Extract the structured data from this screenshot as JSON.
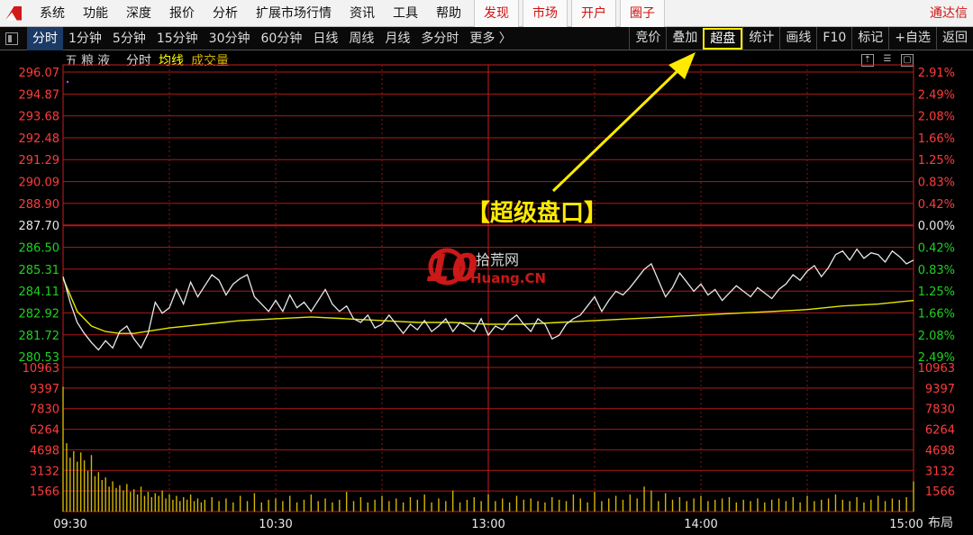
{
  "menubar": {
    "items": [
      "系统",
      "功能",
      "深度",
      "报价",
      "分析",
      "扩展市场行情",
      "资讯",
      "工具",
      "帮助"
    ],
    "red_items": [
      "发现",
      "市场",
      "开户",
      "圈子"
    ],
    "brand": "通达信"
  },
  "toolbar": {
    "periods": [
      "分时",
      "1分钟",
      "5分钟",
      "15分钟",
      "30分钟",
      "60分钟",
      "日线",
      "周线",
      "月线",
      "多分时"
    ],
    "more": "更多 〉",
    "right_buttons": [
      "竞价",
      "叠加",
      "超盘",
      "统计",
      "画线",
      "F10",
      "标记",
      "+自选",
      "返回"
    ],
    "highlighted": "超盘"
  },
  "chart_header": {
    "stock_name": "五粮液",
    "mode": "分时",
    "avg_line": "均线",
    "volume": "成交量"
  },
  "annotation": {
    "label": "【超级盘口】"
  },
  "watermark": {
    "digits": "10",
    "cn": "拾荒网",
    "en": "Huang.CN"
  },
  "bottom_button": "布局",
  "colors": {
    "up": "#ff3b3b",
    "down": "#21d021",
    "avg": "#e6e600",
    "price": "#e8e8e8",
    "volume": "#d4b400",
    "highlight": "#ffea00"
  },
  "chart_data": {
    "type": "line",
    "price_axis": {
      "labels": [
        "296.07",
        "294.87",
        "293.68",
        "292.48",
        "291.29",
        "290.09",
        "288.90",
        "287.70",
        "286.50",
        "285.31",
        "284.11",
        "282.92",
        "281.72",
        "280.53"
      ],
      "ylim": [
        280.53,
        296.07
      ],
      "reference": 287.7
    },
    "pct_axis": {
      "labels": [
        "2.91%",
        "2.49%",
        "2.08%",
        "1.66%",
        "1.25%",
        "0.83%",
        "0.42%",
        "0.00%",
        "0.42%",
        "0.83%",
        "1.25%",
        "1.66%",
        "2.08%",
        "2.49%"
      ]
    },
    "volume_axis": {
      "labels": [
        "10963",
        "9397",
        "7830",
        "6264",
        "4698",
        "3132",
        "1566"
      ],
      "ylim": [
        0,
        10963
      ]
    },
    "time_labels": [
      "09:30",
      "10:30",
      "13:00",
      "14:00",
      "15:00"
    ],
    "minutes_total": 240,
    "price": [
      [
        0,
        284.9
      ],
      [
        2,
        283.5
      ],
      [
        4,
        282.4
      ],
      [
        6,
        281.8
      ],
      [
        8,
        281.3
      ],
      [
        10,
        280.9
      ],
      [
        12,
        281.4
      ],
      [
        14,
        281.0
      ],
      [
        16,
        281.9
      ],
      [
        18,
        282.2
      ],
      [
        20,
        281.5
      ],
      [
        22,
        281.0
      ],
      [
        24,
        281.8
      ],
      [
        26,
        283.5
      ],
      [
        28,
        282.9
      ],
      [
        30,
        283.2
      ],
      [
        32,
        284.2
      ],
      [
        34,
        283.4
      ],
      [
        36,
        284.6
      ],
      [
        38,
        283.8
      ],
      [
        40,
        284.4
      ],
      [
        42,
        285.0
      ],
      [
        44,
        284.7
      ],
      [
        46,
        283.9
      ],
      [
        48,
        284.5
      ],
      [
        50,
        284.8
      ],
      [
        52,
        285.0
      ],
      [
        54,
        283.8
      ],
      [
        56,
        283.4
      ],
      [
        58,
        283.0
      ],
      [
        60,
        283.6
      ],
      [
        62,
        283.0
      ],
      [
        64,
        283.9
      ],
      [
        66,
        283.2
      ],
      [
        68,
        283.5
      ],
      [
        70,
        283.0
      ],
      [
        72,
        283.6
      ],
      [
        74,
        284.2
      ],
      [
        76,
        283.4
      ],
      [
        78,
        283.0
      ],
      [
        80,
        283.3
      ],
      [
        82,
        282.6
      ],
      [
        84,
        282.4
      ],
      [
        86,
        282.8
      ],
      [
        88,
        282.1
      ],
      [
        90,
        282.3
      ],
      [
        92,
        282.8
      ],
      [
        94,
        282.3
      ],
      [
        96,
        281.8
      ],
      [
        98,
        282.3
      ],
      [
        100,
        282.0
      ],
      [
        102,
        282.5
      ],
      [
        104,
        281.9
      ],
      [
        106,
        282.2
      ],
      [
        108,
        282.6
      ],
      [
        110,
        281.9
      ],
      [
        112,
        282.4
      ],
      [
        114,
        282.2
      ],
      [
        116,
        281.9
      ],
      [
        118,
        282.6
      ],
      [
        120,
        281.7
      ],
      [
        122,
        282.2
      ],
      [
        124,
        282.0
      ],
      [
        126,
        282.5
      ],
      [
        128,
        282.8
      ],
      [
        130,
        282.3
      ],
      [
        132,
        281.9
      ],
      [
        134,
        282.6
      ],
      [
        136,
        282.3
      ],
      [
        138,
        281.5
      ],
      [
        140,
        281.7
      ],
      [
        142,
        282.3
      ],
      [
        144,
        282.6
      ],
      [
        146,
        282.8
      ],
      [
        148,
        283.3
      ],
      [
        150,
        283.8
      ],
      [
        152,
        283.0
      ],
      [
        154,
        283.6
      ],
      [
        156,
        284.1
      ],
      [
        158,
        283.9
      ],
      [
        160,
        284.3
      ],
      [
        162,
        284.8
      ],
      [
        164,
        285.3
      ],
      [
        166,
        285.6
      ],
      [
        168,
        284.7
      ],
      [
        170,
        283.8
      ],
      [
        172,
        284.3
      ],
      [
        174,
        285.1
      ],
      [
        176,
        284.6
      ],
      [
        178,
        284.1
      ],
      [
        180,
        284.5
      ],
      [
        182,
        283.9
      ],
      [
        184,
        284.2
      ],
      [
        186,
        283.6
      ],
      [
        188,
        284.0
      ],
      [
        190,
        284.4
      ],
      [
        192,
        284.1
      ],
      [
        194,
        283.8
      ],
      [
        196,
        284.3
      ],
      [
        198,
        284.0
      ],
      [
        200,
        283.7
      ],
      [
        202,
        284.2
      ],
      [
        204,
        284.5
      ],
      [
        206,
        285.0
      ],
      [
        208,
        284.7
      ],
      [
        210,
        285.2
      ],
      [
        212,
        285.5
      ],
      [
        214,
        284.9
      ],
      [
        216,
        285.4
      ],
      [
        218,
        286.1
      ],
      [
        220,
        286.3
      ],
      [
        222,
        285.8
      ],
      [
        224,
        286.4
      ],
      [
        226,
        285.9
      ],
      [
        228,
        286.2
      ],
      [
        230,
        286.1
      ],
      [
        232,
        285.7
      ],
      [
        234,
        286.3
      ],
      [
        236,
        286.0
      ],
      [
        238,
        285.6
      ],
      [
        240,
        285.8
      ]
    ],
    "avg": [
      [
        0,
        284.8
      ],
      [
        4,
        283.0
      ],
      [
        8,
        282.2
      ],
      [
        12,
        281.9
      ],
      [
        16,
        281.8
      ],
      [
        20,
        281.8
      ],
      [
        30,
        282.1
      ],
      [
        40,
        282.3
      ],
      [
        50,
        282.5
      ],
      [
        60,
        282.6
      ],
      [
        70,
        282.7
      ],
      [
        80,
        282.6
      ],
      [
        90,
        282.5
      ],
      [
        100,
        282.4
      ],
      [
        110,
        282.4
      ],
      [
        120,
        282.3
      ],
      [
        130,
        282.3
      ],
      [
        140,
        282.4
      ],
      [
        150,
        282.5
      ],
      [
        160,
        282.6
      ],
      [
        170,
        282.7
      ],
      [
        180,
        282.8
      ],
      [
        190,
        282.9
      ],
      [
        200,
        283.0
      ],
      [
        210,
        283.1
      ],
      [
        220,
        283.3
      ],
      [
        230,
        283.4
      ],
      [
        240,
        283.6
      ]
    ],
    "volume": [
      [
        0,
        9500
      ],
      [
        1,
        5200
      ],
      [
        2,
        4100
      ],
      [
        3,
        4600
      ],
      [
        4,
        3800
      ],
      [
        5,
        4500
      ],
      [
        6,
        3900
      ],
      [
        7,
        3100
      ],
      [
        8,
        4300
      ],
      [
        9,
        2700
      ],
      [
        10,
        3000
      ],
      [
        11,
        2400
      ],
      [
        12,
        2600
      ],
      [
        13,
        1900
      ],
      [
        14,
        2300
      ],
      [
        15,
        1800
      ],
      [
        16,
        2000
      ],
      [
        17,
        1600
      ],
      [
        18,
        2100
      ],
      [
        19,
        1500
      ],
      [
        20,
        1700
      ],
      [
        21,
        1300
      ],
      [
        22,
        1900
      ],
      [
        23,
        1200
      ],
      [
        24,
        1500
      ],
      [
        25,
        1100
      ],
      [
        26,
        1400
      ],
      [
        27,
        1200
      ],
      [
        28,
        1600
      ],
      [
        29,
        1000
      ],
      [
        30,
        1300
      ],
      [
        31,
        900
      ],
      [
        32,
        1200
      ],
      [
        33,
        800
      ],
      [
        34,
        1100
      ],
      [
        35,
        900
      ],
      [
        36,
        1300
      ],
      [
        37,
        800
      ],
      [
        38,
        1000
      ],
      [
        39,
        700
      ],
      [
        40,
        900
      ],
      [
        42,
        1100
      ],
      [
        44,
        800
      ],
      [
        46,
        1000
      ],
      [
        48,
        700
      ],
      [
        50,
        1200
      ],
      [
        52,
        800
      ],
      [
        54,
        1400
      ],
      [
        56,
        700
      ],
      [
        58,
        900
      ],
      [
        60,
        1000
      ],
      [
        62,
        800
      ],
      [
        64,
        1200
      ],
      [
        66,
        700
      ],
      [
        68,
        900
      ],
      [
        70,
        1300
      ],
      [
        72,
        800
      ],
      [
        74,
        1000
      ],
      [
        76,
        700
      ],
      [
        78,
        900
      ],
      [
        80,
        1500
      ],
      [
        82,
        800
      ],
      [
        84,
        1100
      ],
      [
        86,
        700
      ],
      [
        88,
        900
      ],
      [
        90,
        1200
      ],
      [
        92,
        800
      ],
      [
        94,
        1000
      ],
      [
        96,
        700
      ],
      [
        98,
        1100
      ],
      [
        100,
        900
      ],
      [
        102,
        1300
      ],
      [
        104,
        700
      ],
      [
        106,
        1000
      ],
      [
        108,
        800
      ],
      [
        110,
        1600
      ],
      [
        112,
        700
      ],
      [
        114,
        900
      ],
      [
        116,
        1100
      ],
      [
        118,
        800
      ],
      [
        120,
        1300
      ],
      [
        122,
        800
      ],
      [
        124,
        1000
      ],
      [
        126,
        700
      ],
      [
        128,
        1200
      ],
      [
        130,
        900
      ],
      [
        132,
        1000
      ],
      [
        134,
        800
      ],
      [
        136,
        700
      ],
      [
        138,
        1100
      ],
      [
        140,
        900
      ],
      [
        142,
        800
      ],
      [
        144,
        1300
      ],
      [
        146,
        1000
      ],
      [
        148,
        700
      ],
      [
        150,
        1500
      ],
      [
        152,
        800
      ],
      [
        154,
        1000
      ],
      [
        156,
        1200
      ],
      [
        158,
        900
      ],
      [
        160,
        1300
      ],
      [
        162,
        1000
      ],
      [
        164,
        1900
      ],
      [
        166,
        1600
      ],
      [
        168,
        800
      ],
      [
        170,
        1400
      ],
      [
        172,
        900
      ],
      [
        174,
        1100
      ],
      [
        176,
        800
      ],
      [
        178,
        1000
      ],
      [
        180,
        1200
      ],
      [
        182,
        800
      ],
      [
        184,
        900
      ],
      [
        186,
        1000
      ],
      [
        188,
        1100
      ],
      [
        190,
        700
      ],
      [
        192,
        900
      ],
      [
        194,
        800
      ],
      [
        196,
        1000
      ],
      [
        198,
        700
      ],
      [
        200,
        900
      ],
      [
        202,
        1000
      ],
      [
        204,
        800
      ],
      [
        206,
        1100
      ],
      [
        208,
        700
      ],
      [
        210,
        1200
      ],
      [
        212,
        800
      ],
      [
        214,
        900
      ],
      [
        216,
        1000
      ],
      [
        218,
        1300
      ],
      [
        220,
        900
      ],
      [
        222,
        800
      ],
      [
        224,
        1100
      ],
      [
        226,
        700
      ],
      [
        228,
        900
      ],
      [
        230,
        1200
      ],
      [
        232,
        800
      ],
      [
        234,
        1000
      ],
      [
        236,
        900
      ],
      [
        238,
        1100
      ],
      [
        240,
        2300
      ]
    ]
  }
}
